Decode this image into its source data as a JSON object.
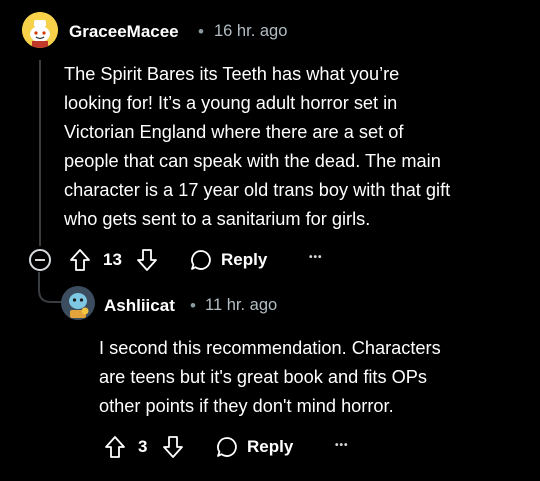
{
  "comment": {
    "author": "GraceeMacee",
    "separator": "•",
    "time": "16 hr. ago",
    "body_lines": [
      "The Spirit Bares its Teeth has what you’re",
      "looking for! It’s a young adult horror set in",
      "Victorian England where there are a set of",
      "people that can speak with the dead. The main",
      "character is a 17 year old trans boy with that gift",
      "who gets sent to a sanitarium for girls."
    ],
    "votes": "13",
    "reply_label": "Reply",
    "more_label": "•••"
  },
  "reply": {
    "author": "Ashliicat",
    "separator": "•",
    "time": "11 hr. ago",
    "body_lines": [
      "I second this recommendation. Characters",
      "are teens but it's great book and fits OPs",
      "other points if they don't mind horror."
    ],
    "votes": "3",
    "reply_label": "Reply",
    "more_label": "•••"
  },
  "colors": {
    "background": "#000000",
    "text": "#ffffff",
    "meta": "#b2bdc3",
    "thread_line": "#3a3d40"
  },
  "icons": [
    "snoo-avatar-icon",
    "collapse-icon",
    "upvote-icon",
    "downvote-icon",
    "reply-bubble-icon",
    "overflow-menu-icon"
  ]
}
